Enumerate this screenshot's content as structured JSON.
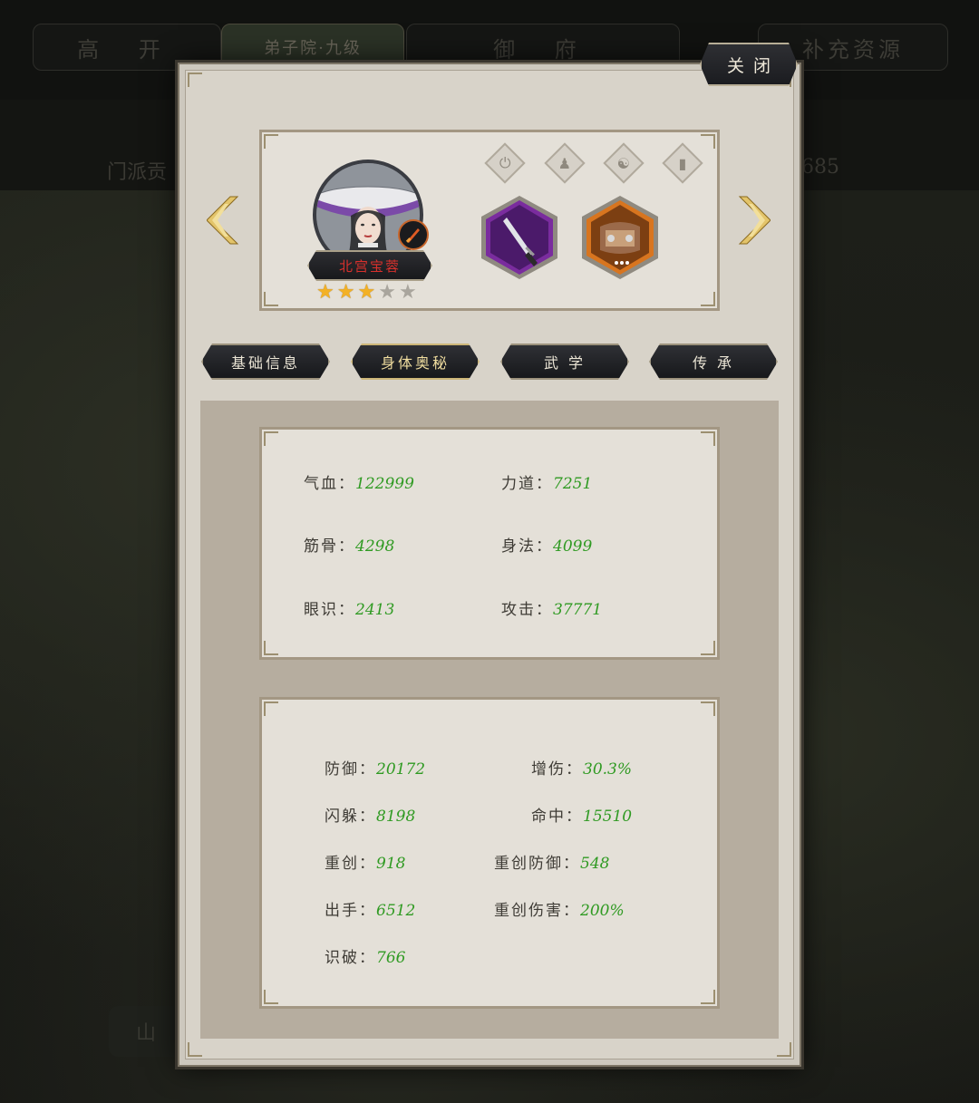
{
  "background": {
    "tabs": [
      "高 开",
      "弟子院·九级",
      "御 府",
      "补充资源"
    ],
    "sub_left": "门派贡",
    "sub_right": "685",
    "corner_button": "山"
  },
  "modal": {
    "close_label": "关闭",
    "character": {
      "name": "北宫宝蓉",
      "stars_total": 5,
      "stars_filled": 3,
      "slot_icons": [
        "power-icon",
        "person-icon",
        "yin-yang-icon",
        "book-icon"
      ],
      "equipment": [
        {
          "icon": "dagger-icon",
          "rarity": "purple",
          "color": "#7a2c9e"
        },
        {
          "icon": "armor-icon",
          "rarity": "orange",
          "color": "#d8751f"
        }
      ]
    },
    "tabs": [
      {
        "label": "基础信息",
        "active": false
      },
      {
        "label": "身体奥秘",
        "active": true
      },
      {
        "label": "武 学",
        "active": false
      },
      {
        "label": "传 承",
        "active": false
      }
    ],
    "basic_stats": [
      {
        "label": "气血：",
        "value": "122999"
      },
      {
        "label": "力道：",
        "value": "7251"
      },
      {
        "label": "筋骨：",
        "value": "4298"
      },
      {
        "label": "身法：",
        "value": "4099"
      },
      {
        "label": "眼识：",
        "value": "2413"
      },
      {
        "label": "攻击：",
        "value": "37771"
      }
    ],
    "advanced_stats": [
      {
        "label": "防御：",
        "value": "20172"
      },
      {
        "label": "增伤：",
        "value": "30.3%"
      },
      {
        "label": "闪躲：",
        "value": "8198"
      },
      {
        "label": "命中：",
        "value": "15510"
      },
      {
        "label": "重创：",
        "value": "918"
      },
      {
        "label": "重创防御：",
        "value": "548"
      },
      {
        "label": "出手：",
        "value": "6512"
      },
      {
        "label": "重创伤害：",
        "value": "200%"
      },
      {
        "label": "识破：",
        "value": "766"
      }
    ]
  }
}
